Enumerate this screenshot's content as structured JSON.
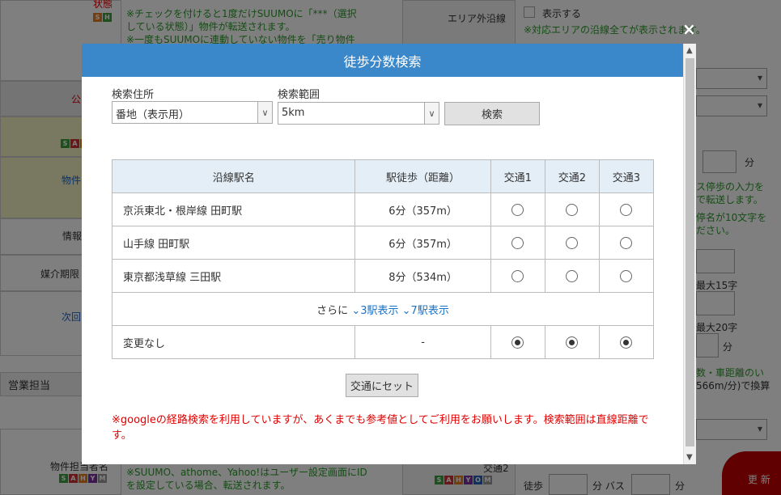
{
  "background": {
    "status_label": "状態",
    "note_line1": "※チェックを付けると1度だけSUUMOに「***（選択",
    "note_line2": "している状態）」物件が転送されます。",
    "note_line3": "※一度もSUUMOに連動していない物件を「売り物件",
    "area_out_label": "エリア外沿線",
    "area_out_check": "表示する",
    "area_out_note": "※対応エリアの沿線全てが表示されます。",
    "left_red": "公",
    "left_property": "物件",
    "left_info": "情報",
    "left_period": "媒介期限",
    "left_next": "次回",
    "sales_rep": "営業担当",
    "rep_name": "物件担当者名",
    "bottom_note1": "※SUUMO、athome、Yahoo!はユーザー設定画面にID",
    "bottom_note2": "を設定している場合、転送されます。",
    "transport2": "交通2",
    "walk": "徒歩",
    "min_bus": "分 バス",
    "min": "分",
    "right_min": "分",
    "right_note1": "ス停歩の入力を",
    "right_note2": "で転送します。",
    "right_note3": "停名が10文字を",
    "right_note4": "ださい。",
    "right_max15": "最大15字",
    "right_max20": "最大20字",
    "right_min2": "分",
    "right_calc1": "数・車距離のい",
    "right_calc2": "566m/分)で換算",
    "update_btn": "更 新",
    "badge_sh": [
      "S",
      "H"
    ],
    "badge_sah": [
      "S",
      "A",
      "H"
    ],
    "badge_sahym": [
      "S",
      "A",
      "H",
      "Y",
      "M"
    ],
    "badge_sahyom": [
      "S",
      "A",
      "H",
      "Y",
      "O",
      "M"
    ]
  },
  "modal": {
    "title": "徒歩分数検索",
    "close": "×",
    "address_label": "検索住所",
    "address_value": "番地（表示用）",
    "range_label": "検索範囲",
    "range_value": "5km",
    "search_button": "検索",
    "table": {
      "headers": [
        "沿線駅名",
        "駅徒歩（距離）",
        "交通1",
        "交通2",
        "交通3"
      ],
      "rows": [
        {
          "name": "京浜東北・根岸線 田町駅",
          "walk": "6分（357m）"
        },
        {
          "name": "山手線 田町駅",
          "walk": "6分（357m）"
        },
        {
          "name": "東京都浅草線 三田駅",
          "walk": "8分（534m）"
        }
      ],
      "more_prefix": "さらに",
      "more_3": "3駅表示",
      "more_7": "7駅表示",
      "nochange_name": "変更なし",
      "nochange_walk": "-"
    },
    "set_button": "交通にセット",
    "note": "※googleの経路検索を利用していますが、あくまでも参考値としてご利用をお願いします。検索範囲は直線距離です。"
  },
  "colors": {
    "header_blue": "#3a87c9",
    "table_head": "#e4eef6",
    "note_red": "#e00000",
    "link_blue": "#1a73c8"
  }
}
